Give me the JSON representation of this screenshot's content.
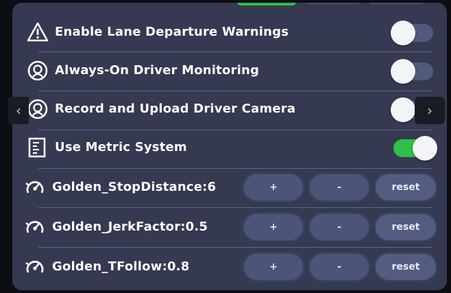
{
  "toggles": [
    {
      "label": "Enable Lane Departure Warnings",
      "icon": "warning-triangle-icon",
      "state": "off"
    },
    {
      "label": "Always-On Driver Monitoring",
      "icon": "driver-monitoring-icon",
      "state": "off"
    },
    {
      "label": "Record and Upload Driver Camera",
      "icon": "driver-camera-icon",
      "state": "off"
    },
    {
      "label": "Use Metric System",
      "icon": "metric-ruler-icon",
      "state": "on"
    }
  ],
  "params": [
    {
      "label": "Golden_StopDistance:6",
      "icon": "gauge-icon",
      "plus": "+",
      "minus": "-",
      "reset": "reset"
    },
    {
      "label": "Golden_JerkFactor:0.5",
      "icon": "gauge-icon",
      "plus": "+",
      "minus": "-",
      "reset": "reset"
    },
    {
      "label": "Golden_TFollow:0.8",
      "icon": "gauge-icon",
      "plus": "+",
      "minus": "-",
      "reset": "reset"
    }
  ],
  "nav": {
    "prev": "‹",
    "next": "›"
  },
  "colors": {
    "panel": "#353a52",
    "toggle_off": "#51597d",
    "toggle_on": "#2fbf4b",
    "button": "#4c5479"
  }
}
